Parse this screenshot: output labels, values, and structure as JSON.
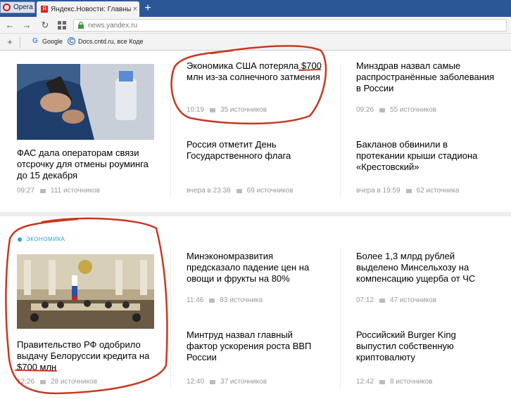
{
  "browser": {
    "menu_label": "Opera",
    "tab_title": "Яндекс.Новости: Главные",
    "new_tab": "+",
    "address": "news.yandex.ru",
    "bookmarks": [
      {
        "icon": "G",
        "label": "Google"
      },
      {
        "icon": "C",
        "label": "Docs.cntd.ru, все Коде"
      }
    ]
  },
  "news_top": [
    {
      "title": "ФАС дала операторам связи отсрочку для отмены роуминга до 15 декабря",
      "time": "09:27",
      "sources": "111 источников"
    },
    {
      "title": "Экономика США потеряла $700 млн из-за солнечного затмения",
      "time": "10:19",
      "sources": "35 источников"
    },
    {
      "title": "Минздрав назвал самые распространённые заболевания в России",
      "time": "09:26",
      "sources": "55 источников"
    },
    {
      "title": "Россия отметит День Государственного флага",
      "time": "вчера в 23:38",
      "sources": "69 источников"
    },
    {
      "title": "Бакланов обвинили в протекании крыши стадиона «Крестовский»",
      "time": "вчера в 19:59",
      "sources": "62 источника"
    }
  ],
  "rubric": "ЭКОНОМИКА",
  "news_bottom": [
    {
      "title": "Правительство РФ одобрило выдачу Белоруссии кредита на $700 млн",
      "time": "12:26",
      "sources": "28 источников"
    },
    {
      "title": "Минэкономразвития предсказало падение цен на овощи и фрукты на 80%",
      "time": "11:46",
      "sources": "83 источника"
    },
    {
      "title": "Более 1,3 млрд рублей выделено Минсельхозу на компенсацию ущерба от ЧС",
      "time": "07:12",
      "sources": "47 источников"
    },
    {
      "title": "Минтруд назвал главный фактор ускорения роста ВВП России",
      "time": "12:40",
      "sources": "37 источников"
    },
    {
      "title": "Российский Burger King выпустил собственную криптовалюту",
      "time": "12:42",
      "sources": "8 источников"
    }
  ],
  "colors": {
    "annotation": "#c8381f",
    "rubric": "#2aa2d6",
    "meta": "#999999"
  }
}
